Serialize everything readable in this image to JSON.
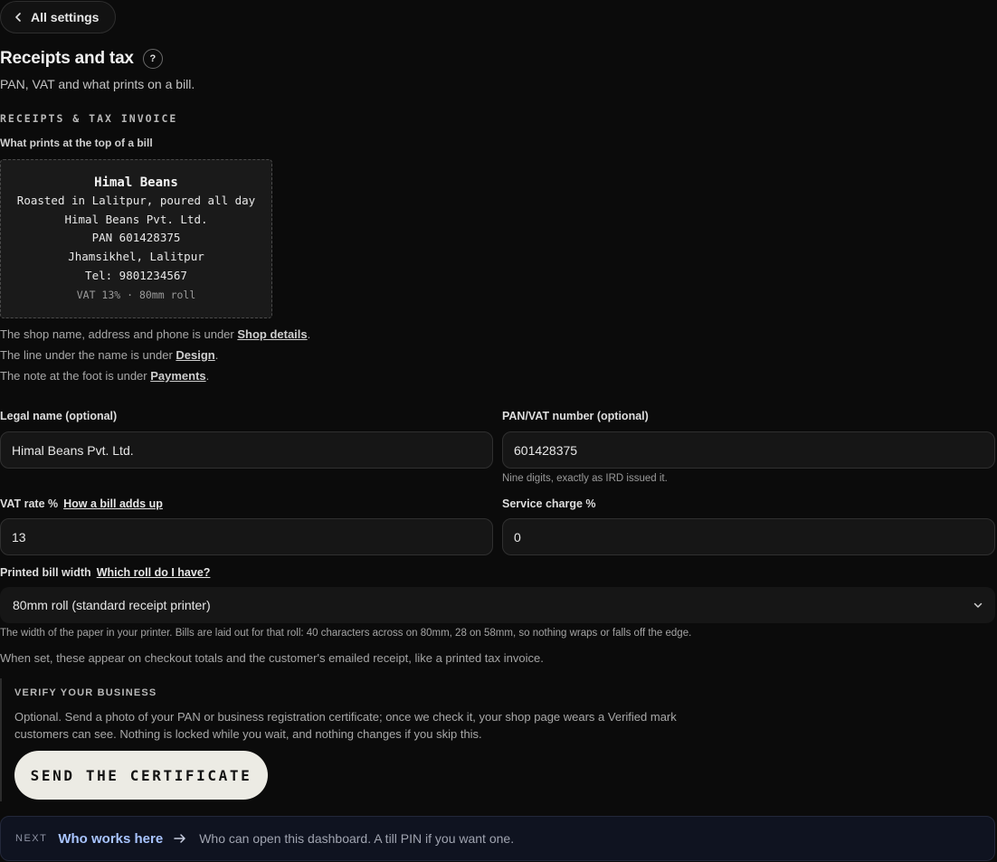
{
  "nav": {
    "back_label": "All settings"
  },
  "page": {
    "title": "Receipts and tax",
    "help": "?",
    "subtitle": "PAN, VAT and what prints on a bill."
  },
  "section": {
    "heading": "RECEIPTS & TAX INVOICE",
    "preview_label": "What prints at the top of a bill"
  },
  "receipt": {
    "name": "Himal Beans",
    "tagline": "Roasted in Lalitpur, poured all day",
    "legal": "Himal Beans Pvt. Ltd.",
    "pan": "PAN 601428375",
    "address": "Jhamsikhel, Lalitpur",
    "tel": "Tel: 9801234567",
    "footer": "VAT 13% · 80mm roll"
  },
  "hints": {
    "line1_pre": "The shop name, address and phone is under ",
    "line1_link": "Shop details",
    "line1_post": ".",
    "line2_pre": "The line under the name is under ",
    "line2_link": "Design",
    "line2_post": ".",
    "line3_pre": "The note at the foot is under ",
    "line3_link": "Payments",
    "line3_post": "."
  },
  "fields": {
    "legal_name": {
      "label": "Legal name (optional)",
      "value": "Himal Beans Pvt. Ltd."
    },
    "pan_vat": {
      "label": "PAN/VAT number (optional)",
      "value": "601428375",
      "hint": "Nine digits, exactly as IRD issued it."
    },
    "vat_rate": {
      "label": "VAT rate %",
      "link": "How a bill adds up",
      "value": "13"
    },
    "service_charge": {
      "label": "Service charge %",
      "value": "0"
    },
    "bill_width": {
      "label": "Printed bill width",
      "link": "Which roll do I have?",
      "value": "80mm roll (standard receipt printer)",
      "hint": "The width of the paper in your printer. Bills are laid out for that roll: 40 characters across on 80mm, 28 on 58mm, so nothing wraps or falls off the edge."
    }
  },
  "info": "When set, these appear on checkout totals and the customer's emailed receipt, like a printed tax invoice.",
  "verify": {
    "title": "VERIFY YOUR BUSINESS",
    "text": "Optional. Send a photo of your PAN or business registration certificate; once we check it, your shop page wears a Verified mark customers can see. Nothing is locked while you wait, and nothing changes if you skip this.",
    "button": "SEND THE CERTIFICATE"
  },
  "next": {
    "tag": "NEXT",
    "title": "Who works here",
    "desc": "Who can open this dashboard. A till PIN if you want one."
  },
  "colors": {
    "background": "#0b0b0b",
    "accent_link": "#a8c4ff",
    "button_bg": "#ecebe4"
  }
}
